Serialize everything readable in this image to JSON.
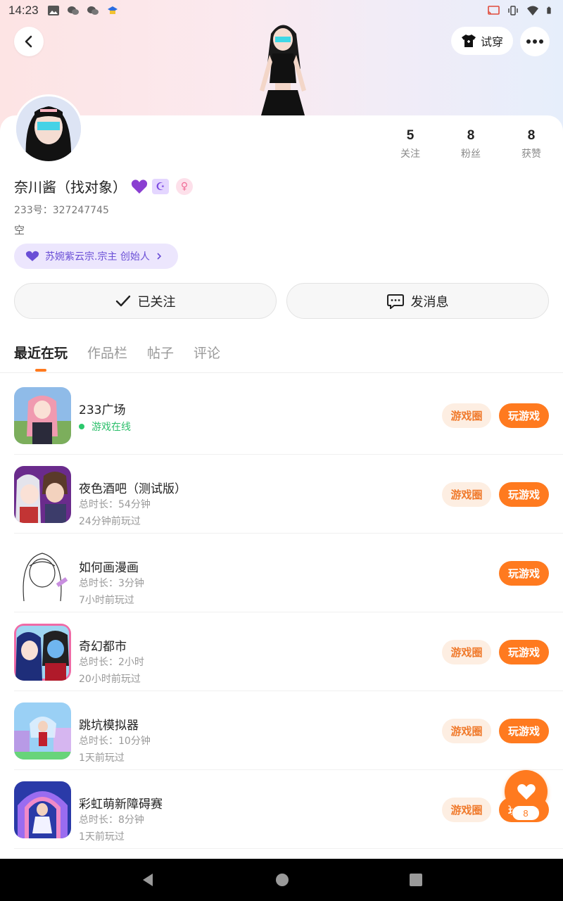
{
  "status_bar": {
    "time": "14:23"
  },
  "header": {
    "tryon_label": "试穿"
  },
  "profile": {
    "nickname": "奈川酱（找对象）",
    "uid": "233号：327247745",
    "bio": "空",
    "guild": "苏婉紫云宗.宗主 创始人",
    "stats": [
      {
        "num": "5",
        "label": "关注"
      },
      {
        "num": "8",
        "label": "粉丝"
      },
      {
        "num": "8",
        "label": "获赞"
      }
    ]
  },
  "actions": {
    "follow_label": "已关注",
    "message_label": "发消息"
  },
  "tabs": [
    "最近在玩",
    "作品栏",
    "帖子",
    "评论"
  ],
  "games": [
    {
      "title": "233广场",
      "line1": "游戏在线",
      "line2": "",
      "circle": "游戏圈",
      "play": "玩游戏"
    },
    {
      "title": "夜色酒吧（测试版）",
      "line1": "总时长：54分钟",
      "line2": "24分钟前玩过",
      "circle": "游戏圈",
      "play": "玩游戏"
    },
    {
      "title": "如何画漫画",
      "line1": "总时长：3分钟",
      "line2": "7小时前玩过",
      "circle": "",
      "play": "玩游戏"
    },
    {
      "title": "奇幻都市",
      "line1": "总时长：2小时",
      "line2": "20小时前玩过",
      "circle": "游戏圈",
      "play": "玩游戏"
    },
    {
      "title": "跳坑模拟器",
      "line1": "总时长：10分钟",
      "line2": "1天前玩过",
      "circle": "游戏圈",
      "play": "玩游戏"
    },
    {
      "title": "彩虹萌新障碍赛",
      "line1": "总时长：8分钟",
      "line2": "1天前玩过",
      "circle": "游戏圈",
      "play": "玩游戏"
    }
  ],
  "fab": {
    "count": "8"
  },
  "colors": {
    "accent": "#ff7a1f",
    "online": "#2cbf6b",
    "guild_bg": "#ece6fd"
  }
}
